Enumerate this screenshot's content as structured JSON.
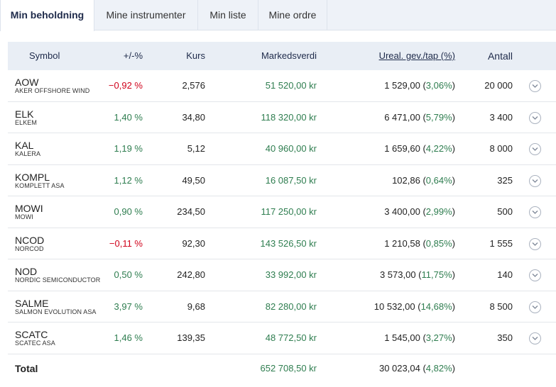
{
  "tabs": [
    {
      "label": "Min beholdning"
    },
    {
      "label": "Mine instrumenter"
    },
    {
      "label": "Min liste"
    },
    {
      "label": "Mine ordre"
    }
  ],
  "columns": {
    "symbol": "Symbol",
    "change": "+/-%",
    "kurs": "Kurs",
    "markedsverdi": "Markedsverdi",
    "ureal": "Ureal. gev./tap (%)",
    "antall": "Antall"
  },
  "rows": [
    {
      "symbol": "AOW",
      "name": "AKER OFFSHORE WIND",
      "change": "−0,92 %",
      "change_dir": "neg",
      "kurs": "2,576",
      "markedsverdi": "51 520,00 kr",
      "gain": "1 529,00",
      "gain_pct": "3,06%",
      "antall": "20 000"
    },
    {
      "symbol": "ELK",
      "name": "ELKEM",
      "change": "1,40 %",
      "change_dir": "pos",
      "kurs": "34,80",
      "markedsverdi": "118 320,00 kr",
      "gain": "6 471,00",
      "gain_pct": "5,79%",
      "antall": "3 400"
    },
    {
      "symbol": "KAL",
      "name": "KALERA",
      "change": "1,19 %",
      "change_dir": "pos",
      "kurs": "5,12",
      "markedsverdi": "40 960,00 kr",
      "gain": "1 659,60",
      "gain_pct": "4,22%",
      "antall": "8 000"
    },
    {
      "symbol": "KOMPL",
      "name": "KOMPLETT ASA",
      "change": "1,12 %",
      "change_dir": "pos",
      "kurs": "49,50",
      "markedsverdi": "16 087,50 kr",
      "gain": "102,86",
      "gain_pct": "0,64%",
      "antall": "325"
    },
    {
      "symbol": "MOWI",
      "name": "MOWI",
      "change": "0,90 %",
      "change_dir": "pos",
      "kurs": "234,50",
      "markedsverdi": "117 250,00 kr",
      "gain": "3 400,00",
      "gain_pct": "2,99%",
      "antall": "500"
    },
    {
      "symbol": "NCOD",
      "name": "NORCOD",
      "change": "−0,11 %",
      "change_dir": "neg",
      "kurs": "92,30",
      "markedsverdi": "143 526,50 kr",
      "gain": "1 210,58",
      "gain_pct": "0,85%",
      "antall": "1 555"
    },
    {
      "symbol": "NOD",
      "name": "NORDIC SEMICONDUCTOR",
      "change": "0,50 %",
      "change_dir": "pos",
      "kurs": "242,80",
      "markedsverdi": "33 992,00 kr",
      "gain": "3 573,00",
      "gain_pct": "11,75%",
      "antall": "140"
    },
    {
      "symbol": "SALME",
      "name": "SALMON EVOLUTION ASA",
      "change": "3,97 %",
      "change_dir": "pos",
      "kurs": "9,68",
      "markedsverdi": "82 280,00 kr",
      "gain": "10 532,00",
      "gain_pct": "14,68%",
      "antall": "8 500"
    },
    {
      "symbol": "SCATC",
      "name": "SCATEC ASA",
      "change": "1,46 %",
      "change_dir": "pos",
      "kurs": "139,35",
      "markedsverdi": "48 772,50 kr",
      "gain": "1 545,00",
      "gain_pct": "3,27%",
      "antall": "350"
    }
  ],
  "total": {
    "label": "Total",
    "markedsverdi": "652 708,50 kr",
    "gain": "30 023,04",
    "gain_pct": "4,82%"
  },
  "colors": {
    "positive": "#2e7d4f",
    "negative": "#d0021b",
    "header_bg": "#e9eef5"
  }
}
